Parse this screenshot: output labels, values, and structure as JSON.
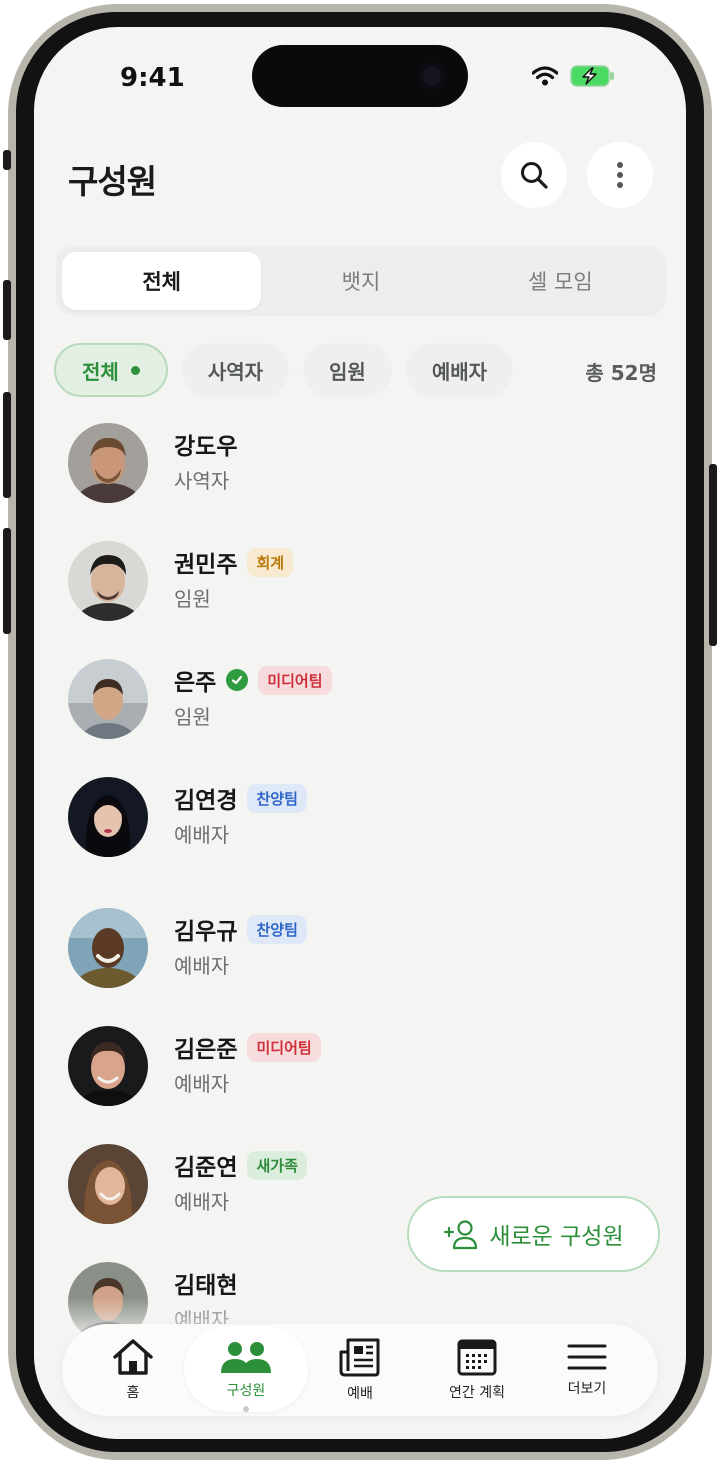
{
  "status_bar": {
    "time": "9:41"
  },
  "header": {
    "title": "구성원"
  },
  "segment_tabs": [
    {
      "label": "전체",
      "active": true
    },
    {
      "label": "뱃지",
      "active": false
    },
    {
      "label": "셀 모임",
      "active": false
    }
  ],
  "filter_chips": [
    {
      "label": "전체",
      "active": true
    },
    {
      "label": "사역자",
      "active": false
    },
    {
      "label": "임원",
      "active": false
    },
    {
      "label": "예배자",
      "active": false
    }
  ],
  "total_count": "총 52명",
  "members": [
    {
      "name": "강도우",
      "role": "사역자"
    },
    {
      "name": "권민주",
      "role": "임원",
      "badge": "회계"
    },
    {
      "name": "은주",
      "role": "임원",
      "badge": "미디어팀",
      "verified": true
    },
    {
      "name": "김연경",
      "role": "예배자",
      "badge": "찬양팀"
    },
    {
      "name": "김우규",
      "role": "예배자",
      "badge": "찬양팀"
    },
    {
      "name": "김은준",
      "role": "예배자",
      "badge": "미디어팀"
    },
    {
      "name": "김준연",
      "role": "예배자",
      "badge": "새가족"
    },
    {
      "name": "김태현",
      "role": "예배자"
    }
  ],
  "fab": {
    "label": "새로운 구성원",
    "icon": "add-user-icon"
  },
  "bottom_nav": [
    {
      "label": "홈",
      "icon": "home-icon"
    },
    {
      "label": "구성원",
      "icon": "members-icon",
      "active": true
    },
    {
      "label": "예배",
      "icon": "newspaper-icon"
    },
    {
      "label": "연간 계획",
      "icon": "calendar-icon"
    },
    {
      "label": "더보기",
      "icon": "menu-icon"
    }
  ],
  "colors": {
    "accent": "#2c8f3a",
    "background": "#f4f5f3"
  }
}
